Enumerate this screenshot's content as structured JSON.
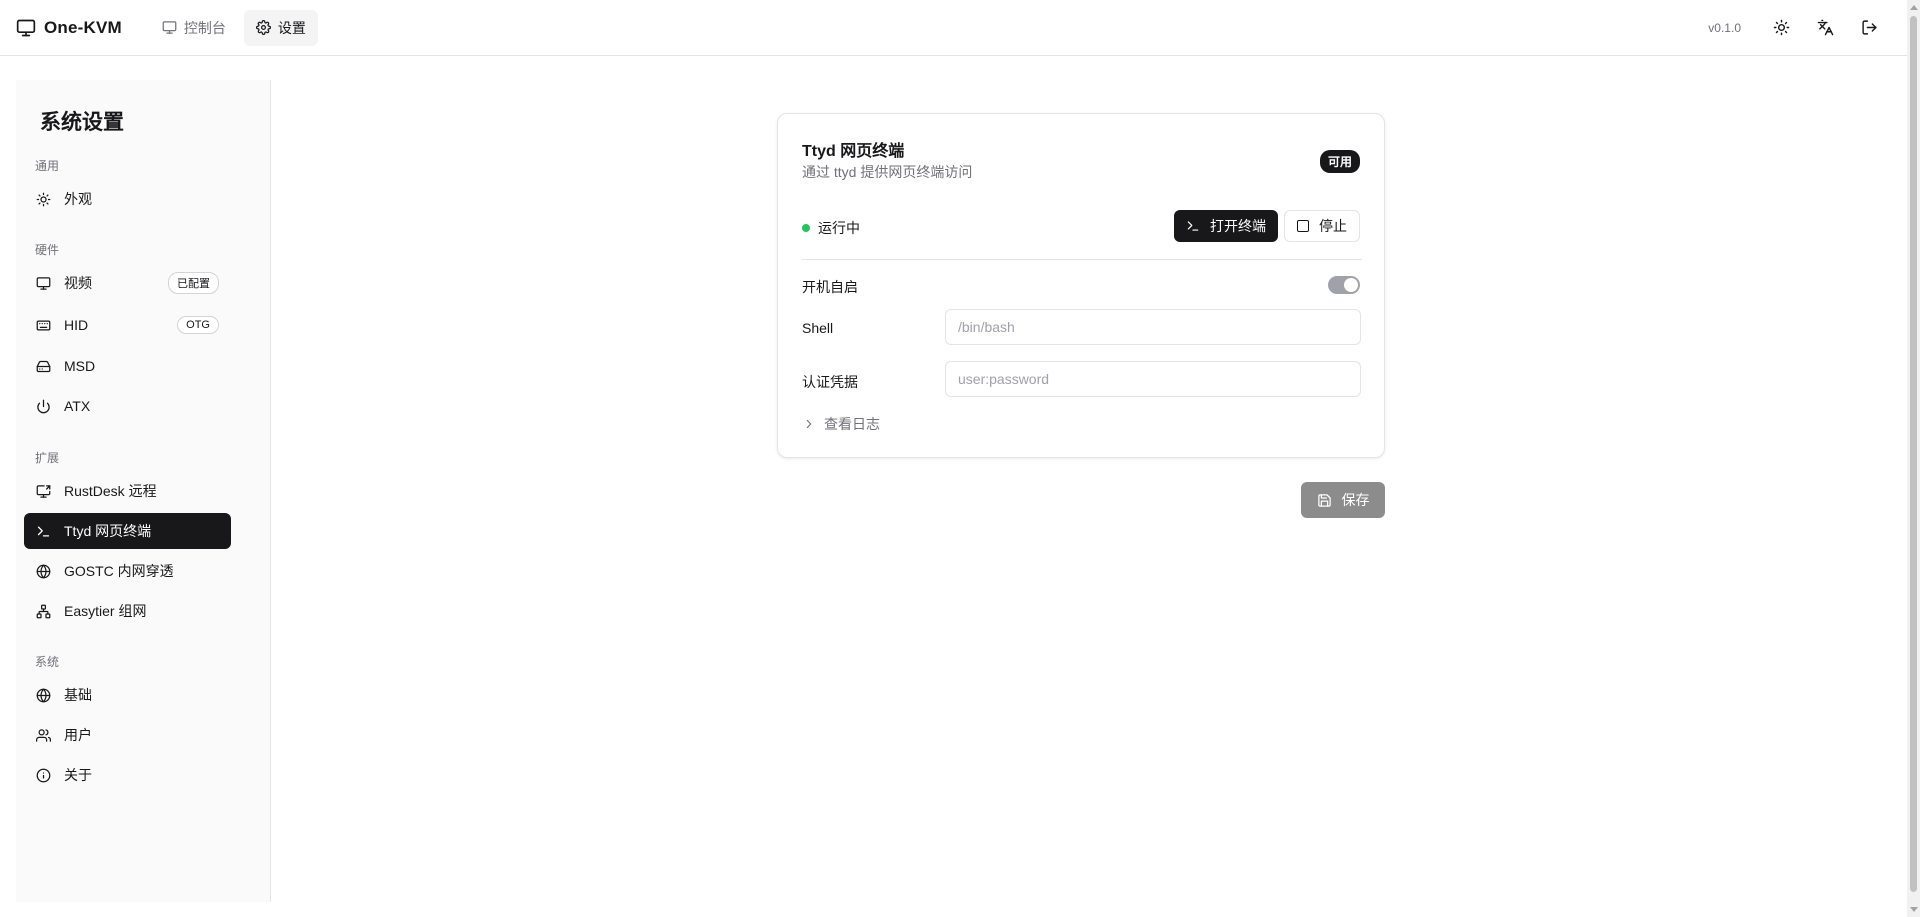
{
  "header": {
    "app_name": "One-KVM",
    "nav": [
      {
        "label": "控制台",
        "icon": "monitor-icon"
      },
      {
        "label": "设置",
        "icon": "gear-icon"
      }
    ],
    "version": "v0.1.0",
    "actions": [
      "sun-icon",
      "translate-icon",
      "logout-icon"
    ]
  },
  "sidebar": {
    "title": "系统设置",
    "groups": [
      {
        "label": "通用",
        "items": [
          {
            "label": "外观",
            "icon": "sun-icon"
          }
        ]
      },
      {
        "label": "硬件",
        "items": [
          {
            "label": "视频",
            "icon": "monitor-icon",
            "badge": "已配置"
          },
          {
            "label": "HID",
            "icon": "keyboard-icon",
            "badge": "OTG"
          },
          {
            "label": "MSD",
            "icon": "hard-drive-icon"
          },
          {
            "label": "ATX",
            "icon": "power-icon"
          }
        ]
      },
      {
        "label": "扩展",
        "items": [
          {
            "label": "RustDesk 远程",
            "icon": "screen-share-icon"
          },
          {
            "label": "Ttyd 网页终端",
            "icon": "terminal-icon",
            "active": true
          },
          {
            "label": "GOSTC 内网穿透",
            "icon": "globe-icon"
          },
          {
            "label": "Easytier 组网",
            "icon": "network-icon"
          }
        ]
      },
      {
        "label": "系统",
        "items": [
          {
            "label": "基础",
            "icon": "globe-icon"
          },
          {
            "label": "用户",
            "icon": "users-icon"
          },
          {
            "label": "关于",
            "icon": "info-icon"
          }
        ]
      }
    ]
  },
  "card": {
    "title": "Ttyd 网页终端",
    "description": "通过 ttyd 提供网页终端访问",
    "badge": "可用",
    "status": "运行中",
    "status_color": "#22c55e",
    "open_button": "打开终端",
    "stop_button": "停止",
    "autostart_label": "开机自启",
    "autostart_on": true,
    "shell_label": "Shell",
    "shell_placeholder": "/bin/bash",
    "auth_label": "认证凭据",
    "auth_placeholder": "user:password",
    "log_toggle": "查看日志"
  },
  "save_button": "保存",
  "colors": {
    "primary": "#18181b",
    "muted": "#71717a",
    "border": "#e4e4e7",
    "success": "#22c55e"
  }
}
